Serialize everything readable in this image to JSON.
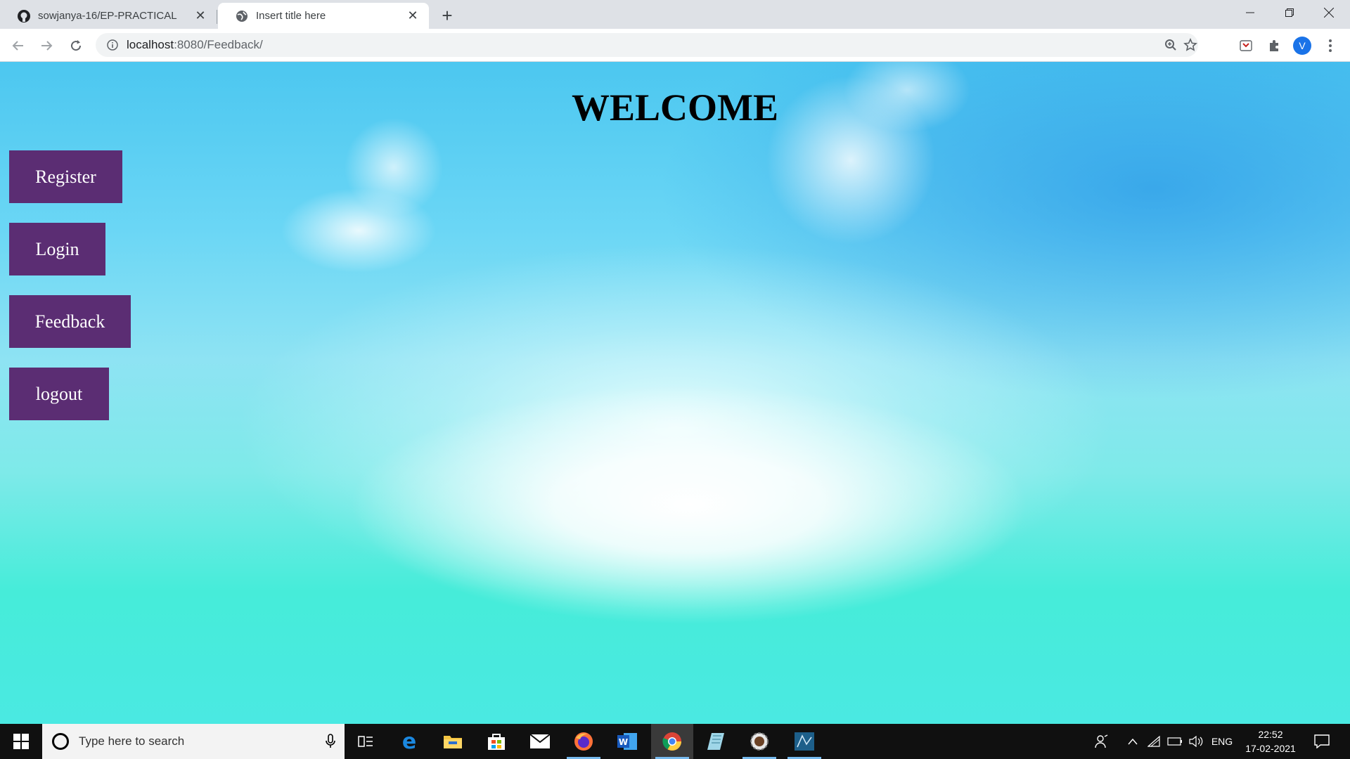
{
  "browser": {
    "tabs": [
      {
        "title": "sowjanya-16/EP-PRACTICAL",
        "favicon": "github-icon",
        "active": false
      },
      {
        "title": "Insert title here",
        "favicon": "globe-icon",
        "active": true
      }
    ],
    "url_host": "localhost",
    "url_rest": ":8080/Feedback/",
    "profile_initial": "V"
  },
  "page": {
    "heading": "WELCOME",
    "buttons": {
      "register": "Register",
      "login": "Login",
      "feedback": "Feedback",
      "logout": "logout"
    },
    "button_color": "#5b2d73"
  },
  "taskbar": {
    "search_placeholder": "Type here to search",
    "apps": [
      "task-view-icon",
      "edge-icon",
      "file-explorer-icon",
      "store-icon",
      "mail-icon",
      "firefox-icon",
      "word-icon",
      "chrome-icon",
      "notepad-icon",
      "settings-app-icon",
      "mysql-icon"
    ],
    "language": "ENG",
    "time": "22:52",
    "date": "17-02-2021"
  }
}
